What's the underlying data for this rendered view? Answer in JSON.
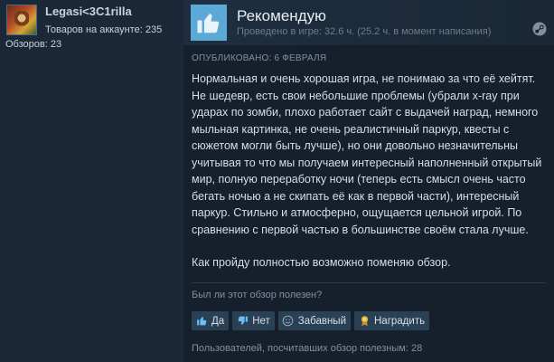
{
  "author": {
    "username": "Legasi<3C1rilla",
    "products_label": "Товаров на аккаунте: 235",
    "reviews_label": "Обзоров: 23"
  },
  "review": {
    "verdict": "Рекомендую",
    "playtime": "Проведено в игре: 32.6 ч. (25.2 ч. в момент написания)",
    "posted": "ОПУБЛИКОВАНО: 6 ФЕВРАЛЯ",
    "paragraphs": [
      "Нормальная и очень хорошая игра, не понимаю за что её хейтят. Не шедевр, есть свои небольшие проблемы (убрали x-ray при ударах по зомби, плохо работает сайт с выдачей наград, немного мыльная картинка, не очень реалистичный паркур, квесты с сюжетом могли быть лучше), но они довольно незначительны учитывая то что мы получаем интересный наполненный открытый мир, полную переработку ночи (теперь есть смысл очень часто бегать ночью а не скипать её как в первой части), интересный паркур. Стильно и атмосферно, ощущается цельной игрой. По сравнению с первой частью в большинстве своём стала лучше.",
      "Как пройду полностью возможно поменяю обзор."
    ],
    "helpful_question": "Был ли этот обзор полезен?",
    "buttons": {
      "yes": "Да",
      "no": "Нет",
      "funny": "Забавный",
      "award": "Наградить"
    },
    "helpful_count": "Пользователей, посчитавших обзор полезным: 28"
  },
  "icons": {
    "recommend": "thumbs-up-icon",
    "platform": "steam-icon",
    "yes": "thumbs-up-icon",
    "no": "thumbs-down-icon",
    "funny": "smiley-icon",
    "award": "award-ribbon-icon"
  },
  "colors": {
    "background": "#1b2838",
    "review_panel": "#16202d",
    "thumb_accent": "#5ba9d6",
    "button": "#2a4055",
    "award": "#e8b23a"
  }
}
